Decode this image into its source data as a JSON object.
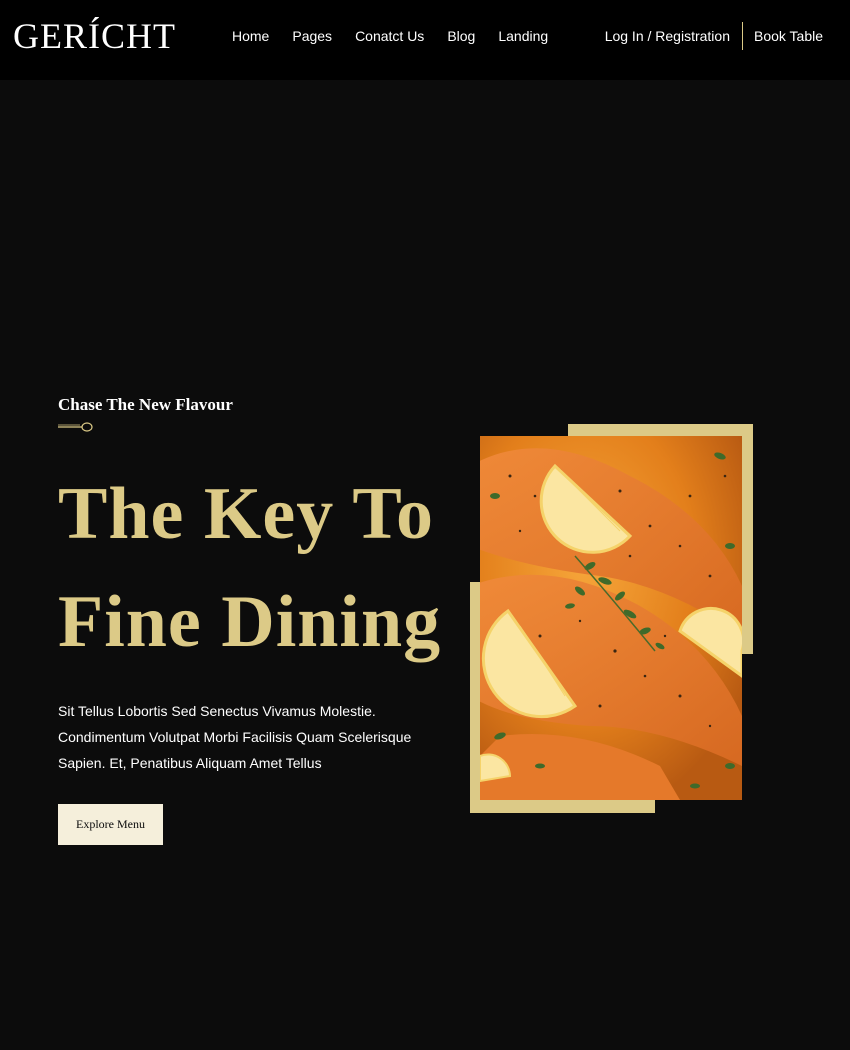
{
  "brand": {
    "logo": "GERÍCHT"
  },
  "nav": {
    "links": [
      {
        "label": "Home"
      },
      {
        "label": "Pages"
      },
      {
        "label": "Conatct Us"
      },
      {
        "label": "Blog"
      },
      {
        "label": "Landing"
      }
    ],
    "login_label": "Log In / Registration",
    "book_label": "Book Table"
  },
  "hero": {
    "subtitle": "Chase The New Flavour",
    "title_line1": "The Key To",
    "title_line2": "Fine Dining",
    "description": "Sit Tellus Lobortis Sed Senectus Vivamus Molestie. Condimentum Volutpat Morbi Facilisis Quam Scelerisque Sapien. Et, Penatibus Aliquam Amet Tellus",
    "cta_label": "Explore Menu",
    "image_icon": "spoon-icon"
  },
  "colors": {
    "background": "#0c0c0c",
    "navbar": "#000000",
    "gold": "#dcca87",
    "button_bg": "#f5efdb",
    "text": "#ffffff"
  }
}
